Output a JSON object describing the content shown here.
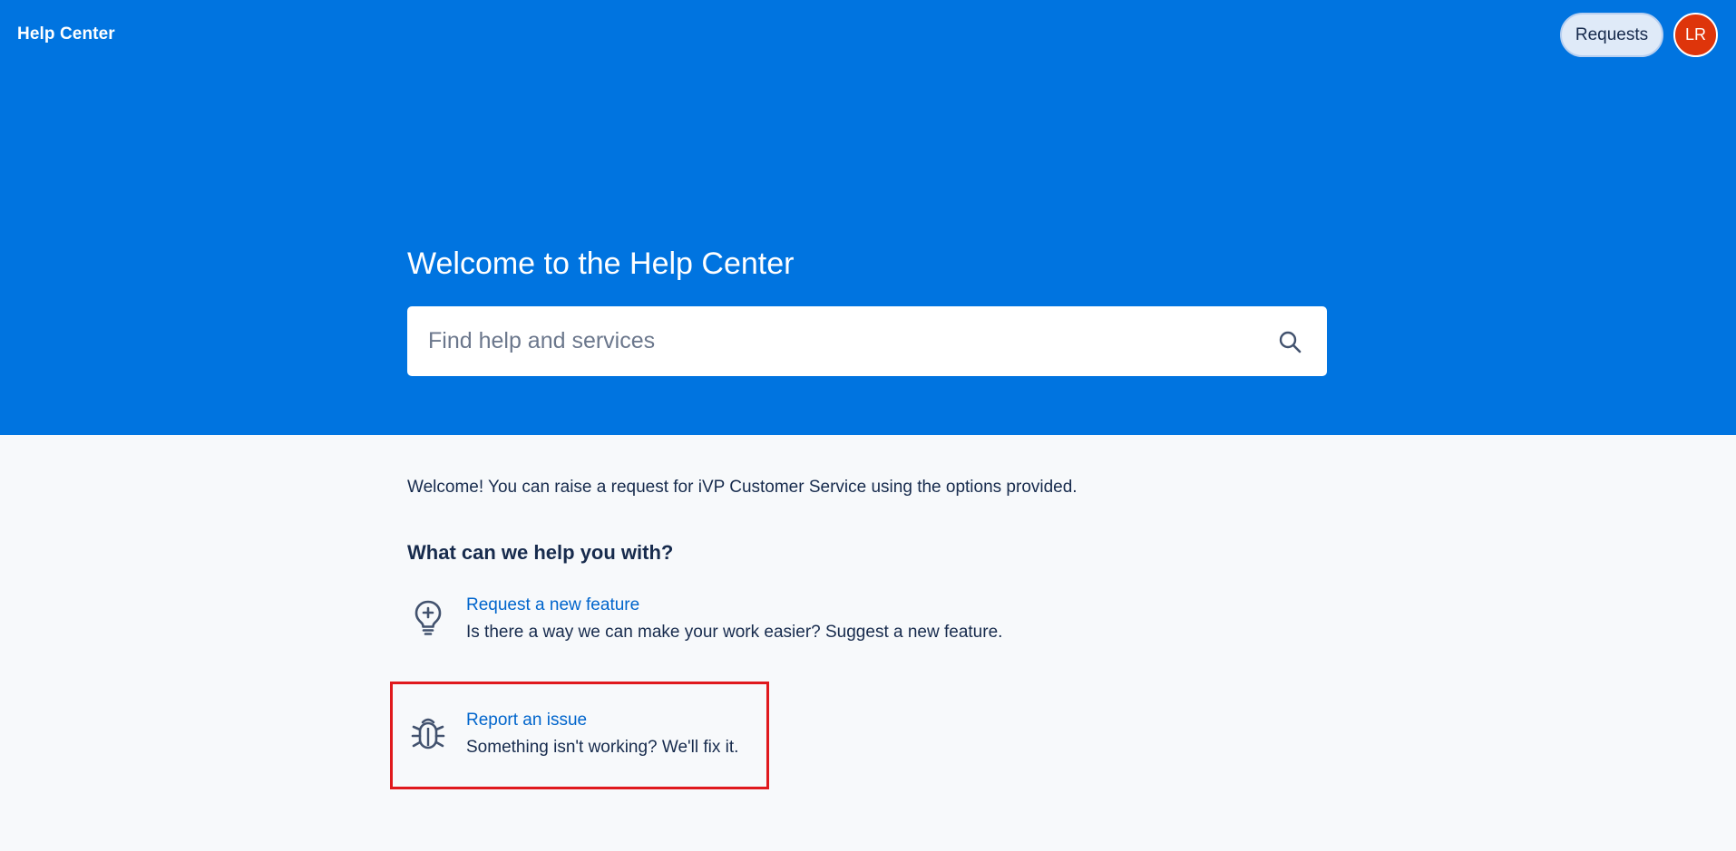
{
  "header": {
    "title": "Help Center",
    "requests_label": "Requests",
    "avatar_initials": "LR"
  },
  "hero": {
    "heading": "Welcome to the Help Center",
    "search": {
      "placeholder": "Find help and services",
      "value": ""
    }
  },
  "main": {
    "intro": "Welcome! You can raise a request for iVP Customer Service using the options provided.",
    "section_heading": "What can we help you with?",
    "options": [
      {
        "icon": "lightbulb-icon",
        "title": "Request a new feature",
        "description": "Is there a way we can make your work easier? Suggest a new feature."
      },
      {
        "icon": "bug-icon",
        "title": "Report an issue",
        "description": "Something isn't working? We'll fix it.",
        "highlighted": true
      }
    ]
  },
  "colors": {
    "hero_background": "#0074e0",
    "page_background": "#f7f9fb",
    "link": "#0065cc",
    "avatar": "#de350b",
    "highlight_border": "#e0191d"
  }
}
